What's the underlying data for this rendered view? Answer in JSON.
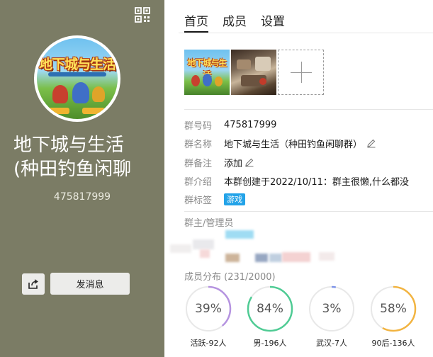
{
  "tabs": [
    {
      "label": "首页",
      "active": true
    },
    {
      "label": "成员",
      "active": false
    },
    {
      "label": "设置",
      "active": false
    }
  ],
  "left": {
    "group_name_line1": "地下城与生活",
    "group_name_line2": "(种田钓鱼闲聊",
    "group_id": "475817999",
    "avatar_logo": "地下城与生活",
    "send_message_label": "发消息",
    "background_color": "#7b7c65"
  },
  "thumbnails": {
    "thumb1_logo": "地下城与生活"
  },
  "info": {
    "number_label": "群号码",
    "number_value": "475817999",
    "name_label": "群名称",
    "name_value": "地下城与生活（种田钓鱼闲聊群）",
    "remark_label": "群备注",
    "remark_value": "添加",
    "intro_label": "群介绍",
    "intro_value": "本群创建于2022/10/11：群主很懒,什么都没",
    "tag_label": "群标签",
    "tag_value": "游戏"
  },
  "admins": {
    "label": "群主/管理员"
  },
  "distribution": {
    "label": "成员分布",
    "count": "(231/2000)",
    "rings": [
      {
        "percent_label": "39%",
        "value": 0.39,
        "caption": "活跃-92人",
        "color": "#b593e0"
      },
      {
        "percent_label": "84%",
        "value": 0.84,
        "caption": "男-196人",
        "color": "#4fcb94"
      },
      {
        "percent_label": "3%",
        "value": 0.03,
        "caption": "武汉-7人",
        "color": "#7f95e8"
      },
      {
        "percent_label": "58%",
        "value": 0.58,
        "caption": "90后-136人",
        "color": "#f2b441"
      }
    ]
  },
  "icons": {
    "qr": "qr-code-icon",
    "share": "share-icon",
    "edit": "pencil-icon",
    "add": "plus-icon"
  },
  "colors": {
    "tag_badge": "#23a3e8"
  }
}
